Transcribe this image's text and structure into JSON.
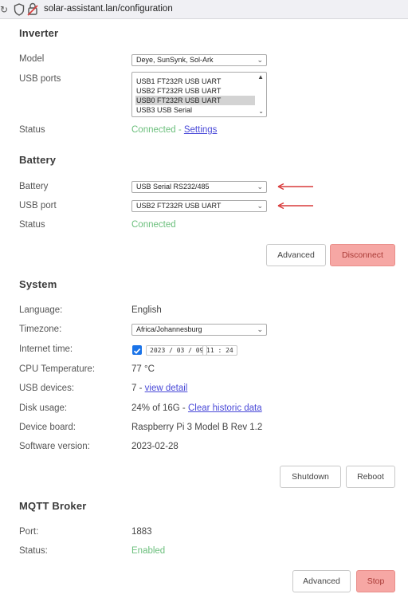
{
  "browser": {
    "url": "solar-assistant.lan/configuration"
  },
  "inverter": {
    "heading": "Inverter",
    "model_label": "Model",
    "model_value": "Deye, SunSynk, Sol-Ark",
    "usb_label": "USB ports",
    "usb_ports": [
      "USB1 FT232R USB UART",
      "USB2 FT232R USB UART",
      "USB0 FT232R USB UART",
      "USB3 USB Serial"
    ],
    "selected_port": "USB0 FT232R USB UART",
    "status_label": "Status",
    "status_value": "Connected",
    "status_sep": " - ",
    "settings_link": "Settings"
  },
  "battery": {
    "heading": "Battery",
    "battery_label": "Battery",
    "battery_value": "USB Serial RS232/485",
    "port_label": "USB port",
    "port_value": "USB2 FT232R USB UART",
    "status_label": "Status",
    "status_value": "Connected",
    "advanced_button": "Advanced",
    "disconnect_button": "Disconnect"
  },
  "system": {
    "heading": "System",
    "language_label": "Language:",
    "language_value": "English",
    "timezone_label": "Timezone:",
    "timezone_value": "Africa/Johannesburg",
    "internet_time_label": "Internet time:",
    "internet_time_checked": true,
    "date_value": "2023 / 03 / 09",
    "time_value": "11 : 24",
    "cpu_label": "CPU Temperature:",
    "cpu_value": "77 °C",
    "usb_devices_label": "USB devices:",
    "usb_devices_value": "7",
    "usb_devices_sep": " - ",
    "view_detail_link": "view detail",
    "disk_label": "Disk usage:",
    "disk_value": "24% of 16G",
    "disk_sep": " - ",
    "clear_history_link": "Clear historic data",
    "board_label": "Device board:",
    "board_value": "Raspberry Pi 3 Model B Rev 1.2",
    "software_label": "Software version:",
    "software_value": "2023-02-28",
    "shutdown_button": "Shutdown",
    "reboot_button": "Reboot"
  },
  "mqtt": {
    "heading": "MQTT Broker",
    "port_label": "Port:",
    "port_value": "1883",
    "status_label": "Status:",
    "status_value": "Enabled",
    "advanced_button": "Advanced",
    "stop_button": "Stop"
  },
  "colors": {
    "status_green": "#6bbf7c",
    "link_blue": "#4a4ad8",
    "danger_button": "#f6a7a4",
    "annotation_arrow": "#d83a3a",
    "checkbox_blue": "#1a73e8"
  }
}
